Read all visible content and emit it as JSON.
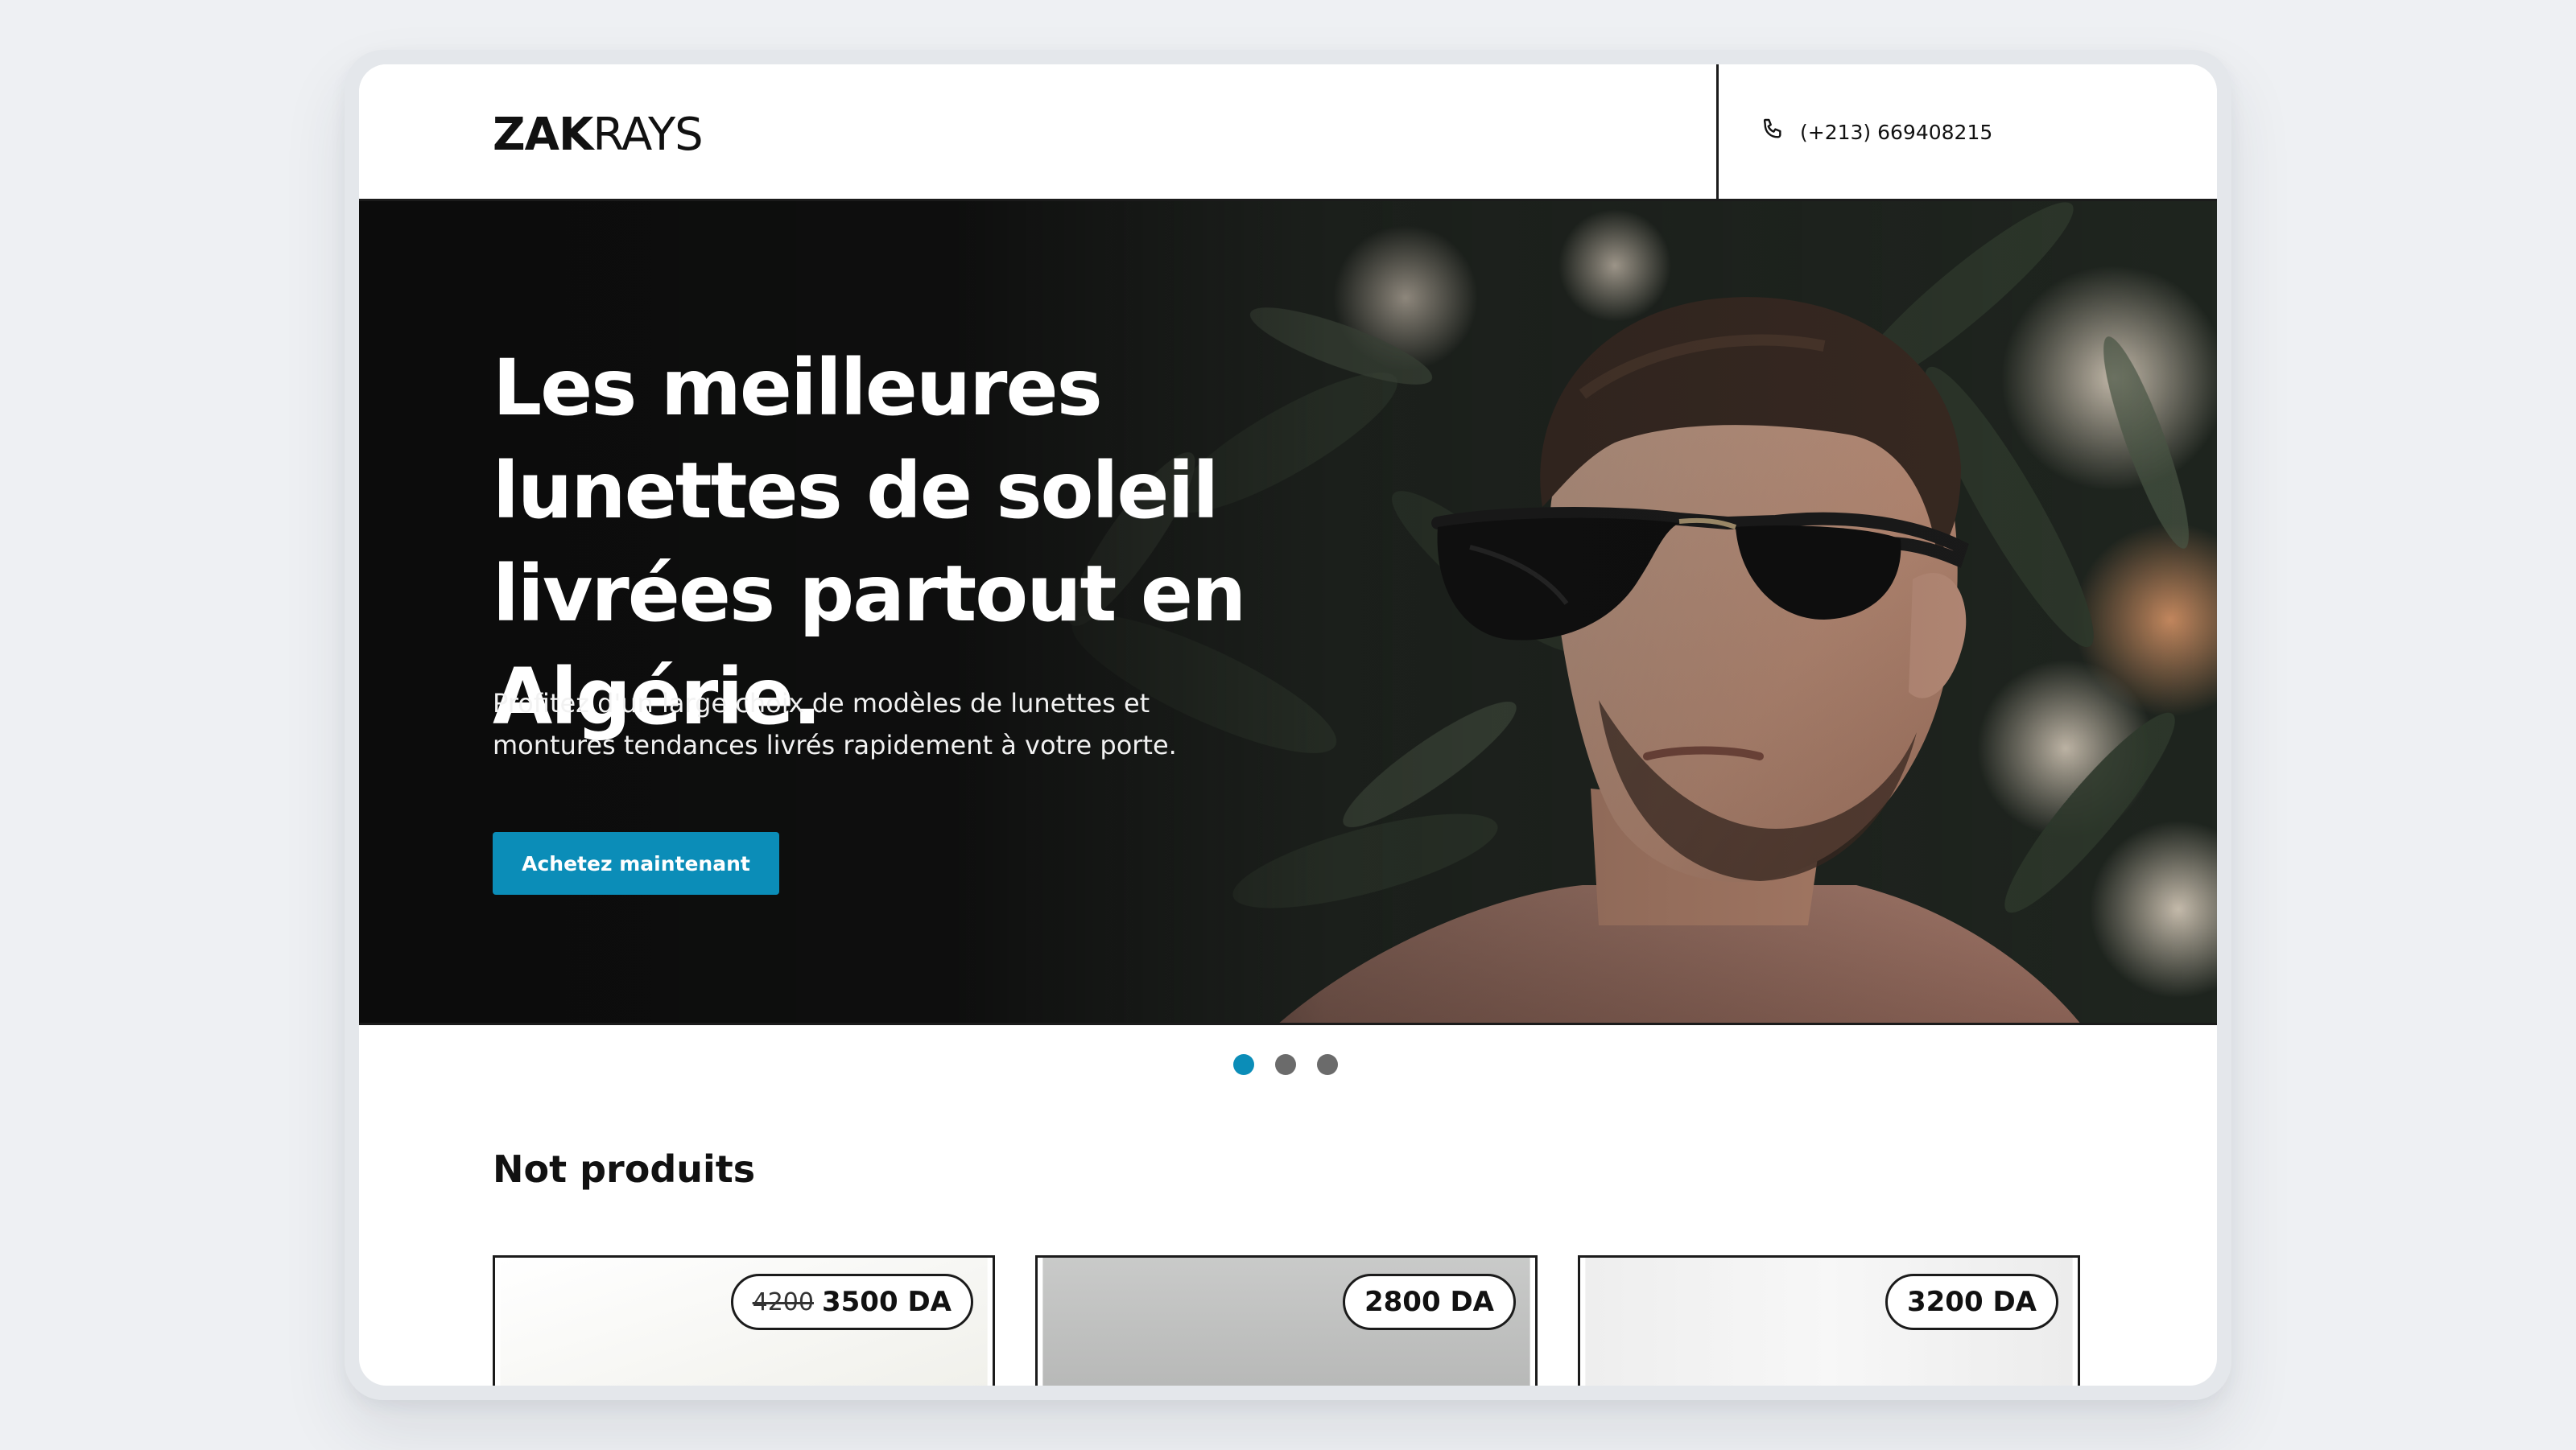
{
  "brand": {
    "logo_bold": "ZAK",
    "logo_light": "RAYS"
  },
  "header": {
    "phone_icon": "phone-icon",
    "phone": "(+213) 669408215"
  },
  "hero": {
    "title": "Les meilleures lunettes de soleil livrées partout en Algérie.",
    "subtitle": "Profitez d'un large choix de modèles de lunettes et montures tendances livrés rapidement à votre porte.",
    "cta_label": "Achetez maintenant",
    "carousel": {
      "slide_count": 3,
      "active_index": 0
    }
  },
  "products": {
    "title": "Not produits",
    "items": [
      {
        "old_price": "4200",
        "price": "3500 DA"
      },
      {
        "old_price": "",
        "price": "2800 DA"
      },
      {
        "old_price": "",
        "price": "3200 DA"
      }
    ]
  },
  "colors": {
    "accent": "#0b8db8",
    "dot_inactive": "#6b6b6b",
    "border": "#1b1b1b"
  }
}
